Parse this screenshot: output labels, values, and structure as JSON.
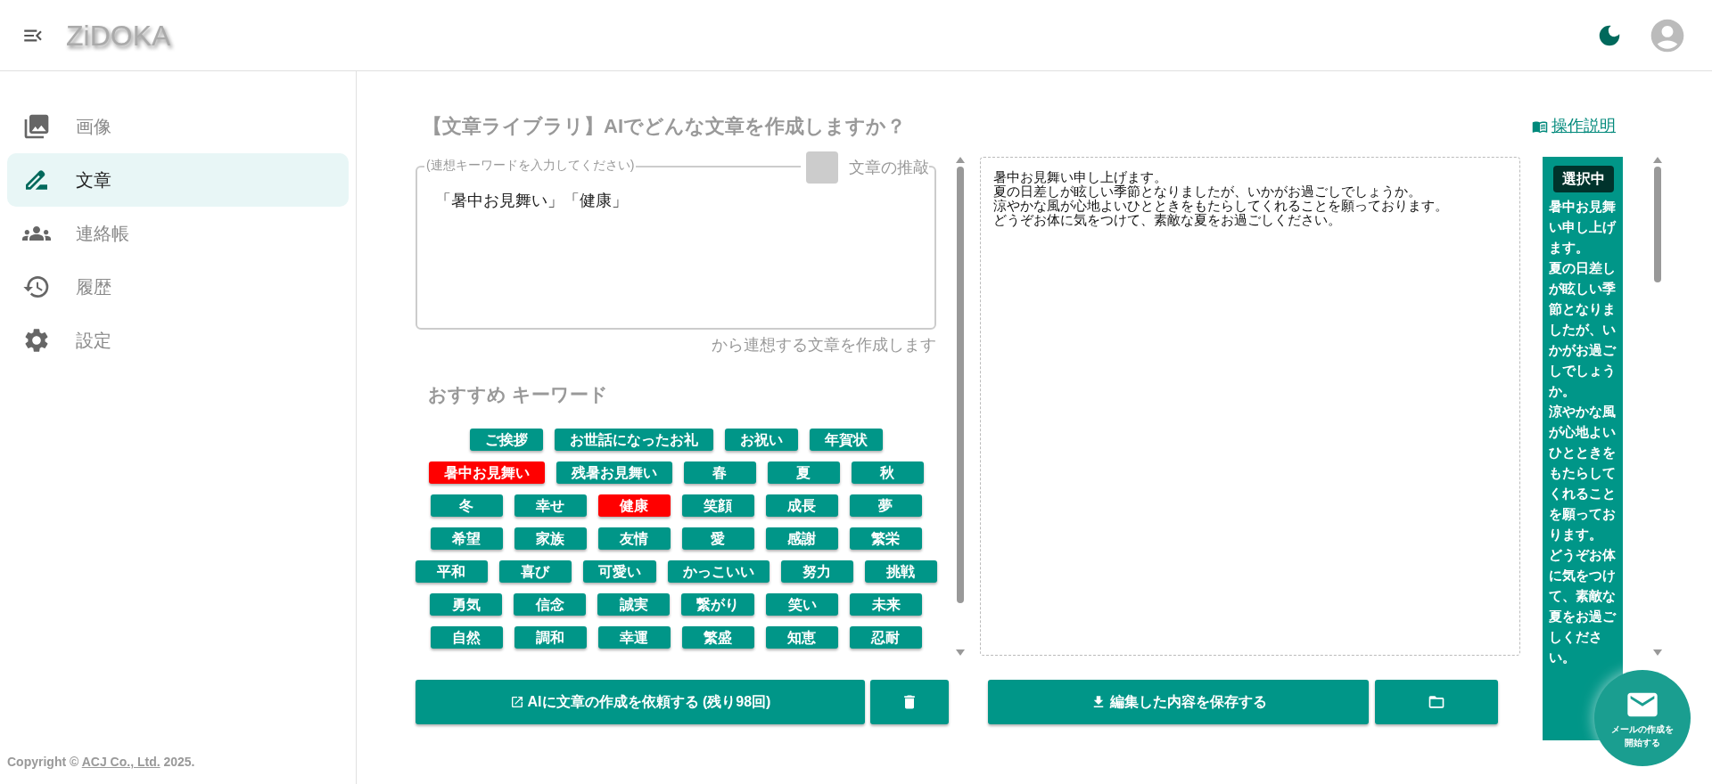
{
  "header": {
    "logo": "ZiDOKA"
  },
  "sidebar": {
    "items": [
      {
        "label": "画像",
        "selected": false
      },
      {
        "label": "文章",
        "selected": true
      },
      {
        "label": "連絡帳",
        "selected": false
      },
      {
        "label": "履歴",
        "selected": false
      },
      {
        "label": "設定",
        "selected": false
      }
    ]
  },
  "copyright": {
    "before": "Copyright ©",
    "link": "ACJ Co., Ltd.",
    "after": "2025."
  },
  "title": "【文章ライブラリ】AIでどんな文章を作成しますか？",
  "help_link": "操作説明",
  "keyword_field": {
    "label": "(連想キーワードを入力してください)",
    "value": "「暑中お見舞い」「健康」"
  },
  "refine_toggle": {
    "label": "文章の推敲",
    "checked": false
  },
  "hint": "から連想する文章を作成します",
  "recommended": {
    "title": "おすすめ キーワード",
    "keywords": [
      {
        "label": "ご挨拶",
        "selected": false
      },
      {
        "label": "お世話になったお礼",
        "selected": false
      },
      {
        "label": "お祝い",
        "selected": false
      },
      {
        "label": "年賀状",
        "selected": false
      },
      {
        "label": "暑中お見舞い",
        "selected": true
      },
      {
        "label": "残暑お見舞い",
        "selected": false
      },
      {
        "label": "春",
        "selected": false
      },
      {
        "label": "夏",
        "selected": false
      },
      {
        "label": "秋",
        "selected": false
      },
      {
        "label": "冬",
        "selected": false
      },
      {
        "label": "幸せ",
        "selected": false
      },
      {
        "label": "健康",
        "selected": true
      },
      {
        "label": "笑顔",
        "selected": false
      },
      {
        "label": "成長",
        "selected": false
      },
      {
        "label": "夢",
        "selected": false
      },
      {
        "label": "希望",
        "selected": false
      },
      {
        "label": "家族",
        "selected": false
      },
      {
        "label": "友情",
        "selected": false
      },
      {
        "label": "愛",
        "selected": false
      },
      {
        "label": "感謝",
        "selected": false
      },
      {
        "label": "繁栄",
        "selected": false
      },
      {
        "label": "平和",
        "selected": false
      },
      {
        "label": "喜び",
        "selected": false
      },
      {
        "label": "可愛い",
        "selected": false
      },
      {
        "label": "かっこいい",
        "selected": false
      },
      {
        "label": "努力",
        "selected": false
      },
      {
        "label": "挑戦",
        "selected": false
      },
      {
        "label": "勇気",
        "selected": false
      },
      {
        "label": "信念",
        "selected": false
      },
      {
        "label": "誠実",
        "selected": false
      },
      {
        "label": "繋がり",
        "selected": false
      },
      {
        "label": "笑い",
        "selected": false
      },
      {
        "label": "未来",
        "selected": false
      },
      {
        "label": "自然",
        "selected": false
      },
      {
        "label": "調和",
        "selected": false
      },
      {
        "label": "幸運",
        "selected": false
      },
      {
        "label": "繁盛",
        "selected": false
      },
      {
        "label": "知恵",
        "selected": false
      },
      {
        "label": "忍耐",
        "selected": false
      }
    ]
  },
  "generated_text": [
    "暑中お見舞い申し上げます。",
    "夏の日差しが眩しい季節となりましたが、いかがお過ごしでしょうか。",
    "涼やかな風が心地よいひとときをもたらしてくれることを願っております。",
    "どうぞお体に気をつけて、素敵な夏をお過ごしください。"
  ],
  "request_button": "AIに文章の作成を依頼する (残り98回)",
  "save_button": "編集した内容を保存する",
  "preview": {
    "badge": "選択中",
    "lines": [
      "暑中お見舞い申し上げます。",
      "夏の日差しが眩しい季節となりましたが、いかがお過ごしでしょうか。",
      "涼やかな風が心地よいひとときをもたらしてくれることを願っております。",
      "どうぞお体に気をつけて、素敵な夏をお過ごしください。"
    ]
  },
  "mail_fab": {
    "lines": [
      "メールの作成を",
      "開始する"
    ]
  }
}
